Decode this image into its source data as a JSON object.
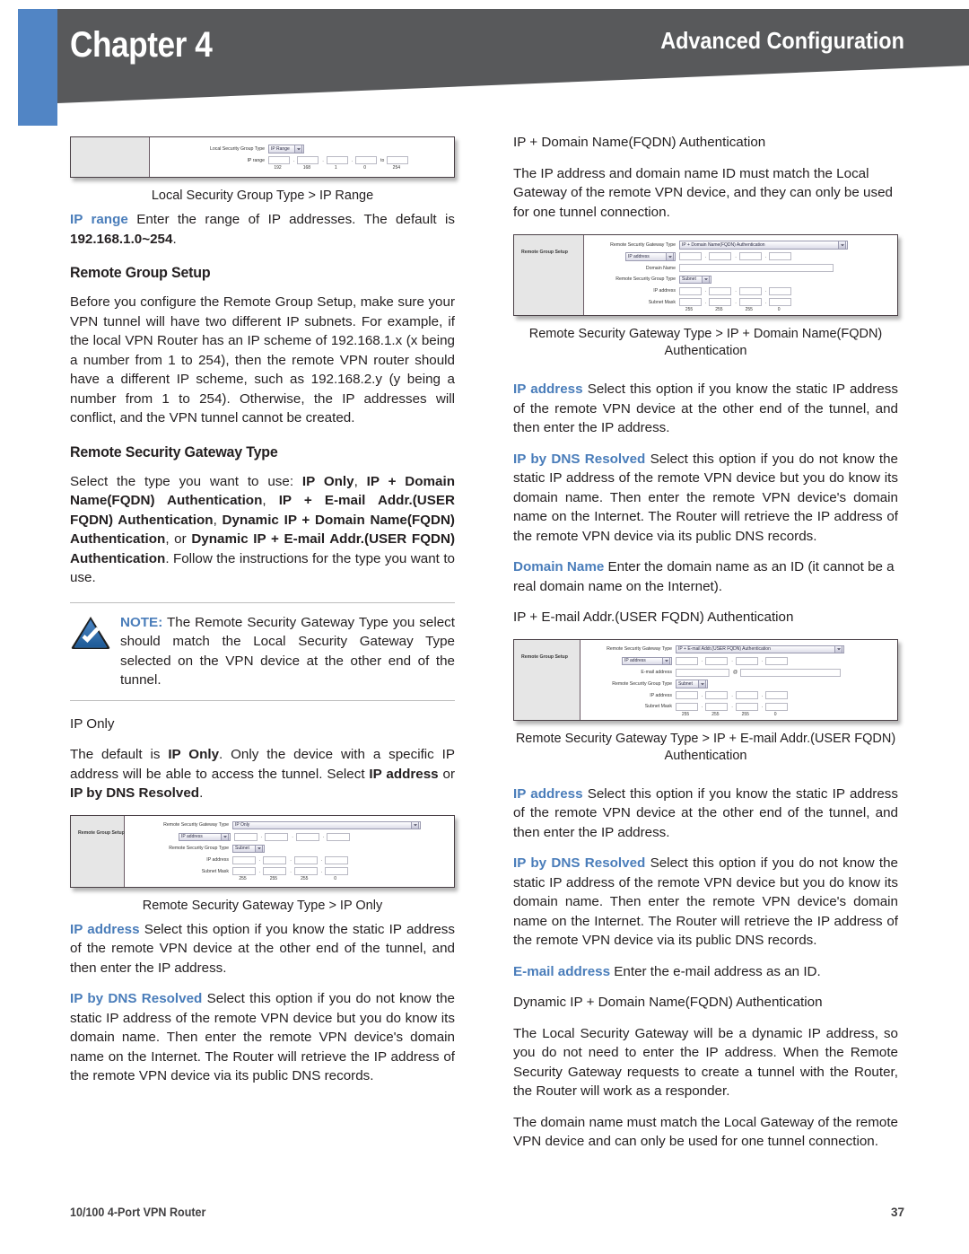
{
  "header": {
    "chapter": "Chapter 4",
    "section": "Advanced Configuration",
    "accent_blue": "#5185c5",
    "band_gray": "#58595b"
  },
  "theme": {
    "term_blue": "#4a7dba",
    "body_text": "#231f20"
  },
  "left_column": {
    "figure1": {
      "caption": "Local Security Group Type > IP Range",
      "panel_title": "",
      "rows": [
        {
          "label": "Local Security Group Type",
          "control": "select",
          "value": "IP Range"
        },
        {
          "label": "IP range",
          "control": "octets",
          "values": [
            "192",
            "168",
            "1",
            "0"
          ],
          "to_label": "to",
          "to_value": "254"
        }
      ]
    },
    "para_ip_range": {
      "term": "IP range",
      "text": " Enter the range of IP addresses. The default is ",
      "bold_value": "192.168.1.0~254",
      "tail": "."
    },
    "heading_remote_group_setup": "Remote Group Setup",
    "para_before_configure": "Before you configure the Remote Group Setup, make sure your VPN tunnel will have two different IP subnets. For example, if the local VPN Router has an IP scheme of 192.168.1.x (x being a number from 1 to 254), then the remote VPN router should have a different IP scheme, such as 192.168.2.y (y being a number from 1 to 254). Otherwise, the IP addresses will conflict, and the VPN tunnel cannot be created.",
    "heading_remote_security_gateway_type": "Remote Security Gateway Type",
    "para_select_type": {
      "lead": "Select the type you want to use: ",
      "options": [
        "IP Only",
        "IP + Domain Name(FQDN) Authentication",
        "IP + E-mail Addr.(USER FQDN) Authentication",
        "Dynamic IP + Domain Name(FQDN) Authentication",
        "Dynamic IP + E-mail Addr.(USER FQDN) Authentication"
      ],
      "tail": ". Follow the instructions for the type you want to use."
    },
    "note": {
      "keyword": "NOTE:",
      "text": " The Remote Security Gateway Type you select should match the Local Security Gateway Type selected on the VPN device at the other end of the tunnel.",
      "icon": "note-check-icon"
    },
    "heading_ip_only": "IP Only",
    "para_default_ip_only": {
      "lead": "The default is ",
      "b1": "IP Only",
      "mid": ". Only the device with a specific IP address will be able to access the tunnel. Select ",
      "b2": "IP address",
      "mid2": " or ",
      "b3": "IP by DNS Resolved",
      "tail": "."
    },
    "figure2": {
      "caption": "Remote Security Gateway Type > IP Only",
      "panel_title": "Remote Group Setup",
      "rows": [
        {
          "label": "Remote Security Gateway Type",
          "control": "wide-select",
          "value": "IP Only"
        },
        {
          "label": "",
          "control": "select-plus-octets",
          "value": "IP address",
          "values": [
            "",
            "",
            "",
            ""
          ]
        },
        {
          "label": "Remote Security Group Type",
          "control": "select",
          "value": "Subnet"
        },
        {
          "label": "IP address",
          "control": "octets",
          "values": [
            "",
            "",
            "",
            ""
          ]
        },
        {
          "label": "Subnet Mask",
          "control": "octets",
          "values": [
            "255",
            "255",
            "255",
            "0"
          ]
        }
      ]
    },
    "para_ip_address": {
      "term": "IP address",
      "text": " Select this option if you know the static IP address of the remote VPN device at the other end of the tunnel, and then enter the IP address."
    },
    "para_ip_by_dns": {
      "term": "IP by DNS Resolved",
      "text": " Select this option if you do not know the static IP address of the remote VPN device but you do know its domain name. Then enter the remote VPN device's domain name on the Internet. The Router will retrieve the IP address of the remote VPN device via its public DNS records."
    }
  },
  "right_column": {
    "heading_ip_domain_fqdn": "IP + Domain Name(FQDN) Authentication",
    "para_ip_domain_intro": "The IP address and domain name ID must match the Local Gateway of the remote VPN device, and they can only be used for one tunnel connection.",
    "figure3": {
      "caption_line1": "Remote Security Gateway Type > IP + Domain Name(FQDN)",
      "caption_line2": "Authentication",
      "panel_title": "Remote Group Setup",
      "rows": [
        {
          "label": "Remote Security Gateway Type",
          "control": "wide-select",
          "value": "IP + Domain Name(FQDN) Authentication"
        },
        {
          "label": "",
          "control": "select-plus-octets",
          "value": "IP address",
          "values": [
            "",
            "",
            "",
            ""
          ]
        },
        {
          "label": "Domain Name",
          "control": "text",
          "value": ""
        },
        {
          "label": "Remote Security Group Type",
          "control": "select",
          "value": "Subnet"
        },
        {
          "label": "IP address",
          "control": "octets",
          "values": [
            "",
            "",
            "",
            ""
          ]
        },
        {
          "label": "Subnet Mask",
          "control": "octets",
          "values": [
            "255",
            "255",
            "255",
            "0"
          ]
        }
      ]
    },
    "para_ip_address_2": {
      "term": "IP address",
      "text": " Select this option if you know the static IP address of the remote VPN device at the other end of the tunnel, and then enter the IP address."
    },
    "para_ip_by_dns_2": {
      "term": "IP by DNS Resolved",
      "text": " Select this option if you do not know the static IP address of the remote VPN device but you do know its domain name. Then enter the remote VPN device's domain name on the Internet. The Router will retrieve the IP address of the remote VPN device via its public DNS records."
    },
    "para_domain_name": {
      "term": "Domain Name",
      "text": "  Enter the domain name as an ID (it cannot be a real domain name on the Internet)."
    },
    "heading_ip_email_fqdn": "IP + E-mail Addr.(USER FQDN) Authentication",
    "figure4": {
      "caption_line1": "Remote Security Gateway Type > IP + E-mail Addr.(USER FQDN)",
      "caption_line2": "Authentication",
      "panel_title": "Remote Group Setup",
      "rows": [
        {
          "label": "Remote Security Gateway Type",
          "control": "wide-select",
          "value": "IP + E-mail Addr.(USER FQDN) Authentication"
        },
        {
          "label": "",
          "control": "select-plus-octets",
          "value": "IP address",
          "values": [
            "",
            "",
            "",
            ""
          ]
        },
        {
          "label": "E-mail address",
          "control": "email",
          "value": "",
          "at": "@",
          "value2": ""
        },
        {
          "label": "Remote Security Group Type",
          "control": "select",
          "value": "Subnet"
        },
        {
          "label": "IP address",
          "control": "octets",
          "values": [
            "",
            "",
            "",
            ""
          ]
        },
        {
          "label": "Subnet Mask",
          "control": "octets",
          "values": [
            "255",
            "255",
            "255",
            "0"
          ]
        }
      ]
    },
    "para_ip_address_3": {
      "term": "IP address",
      "text": " Select this option if you know the static IP address of the remote VPN device at the other end of the tunnel, and then enter the IP address."
    },
    "para_ip_by_dns_3": {
      "term": "IP by DNS Resolved",
      "text": " Select this option if you do not know the static IP address of the remote VPN device but you do know its domain name. Then enter the remote VPN device's domain name on the Internet. The Router will retrieve the IP address of the remote VPN device via its public DNS records."
    },
    "para_email_address": {
      "term": "E-mail address",
      "text": "  Enter the e-mail address as an ID."
    },
    "heading_dynamic_ip_domain": "Dynamic IP + Domain Name(FQDN) Authentication",
    "para_dynamic_local": "The Local Security Gateway will be a dynamic IP address, so you do not need to enter the IP address. When the Remote Security Gateway requests to create a tunnel with the Router, the Router will work as a responder.",
    "para_domain_must_match": "The domain name must match the Local Gateway of the remote VPN device and can only be used for one tunnel connection."
  },
  "footer": {
    "product": "10/100 4-Port VPN Router",
    "page": "37"
  }
}
